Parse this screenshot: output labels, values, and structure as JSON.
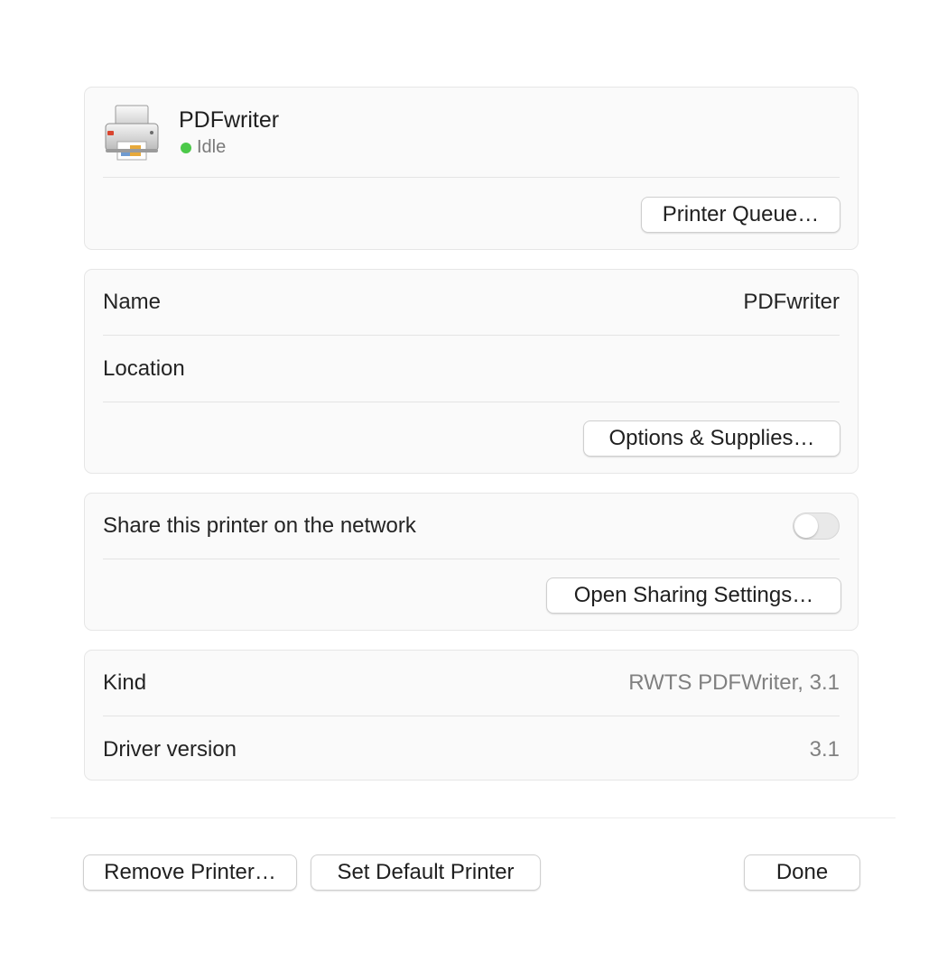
{
  "printer": {
    "name": "PDFwriter",
    "status": "Idle",
    "status_color": "#4cc94a",
    "icon": "printer-icon",
    "queue_button": "Printer Queue…"
  },
  "info": {
    "name_label": "Name",
    "name_value": "PDFwriter",
    "location_label": "Location",
    "location_value": "",
    "options_button": "Options & Supplies…"
  },
  "sharing": {
    "share_label": "Share this printer on the network",
    "share_enabled": false,
    "open_settings_button": "Open Sharing Settings…"
  },
  "details": {
    "kind_label": "Kind",
    "kind_value": "RWTS PDFWriter, 3.1",
    "driver_label": "Driver version",
    "driver_value": "3.1"
  },
  "footer": {
    "remove_button": "Remove Printer…",
    "default_button": "Set Default Printer",
    "done_button": "Done"
  }
}
